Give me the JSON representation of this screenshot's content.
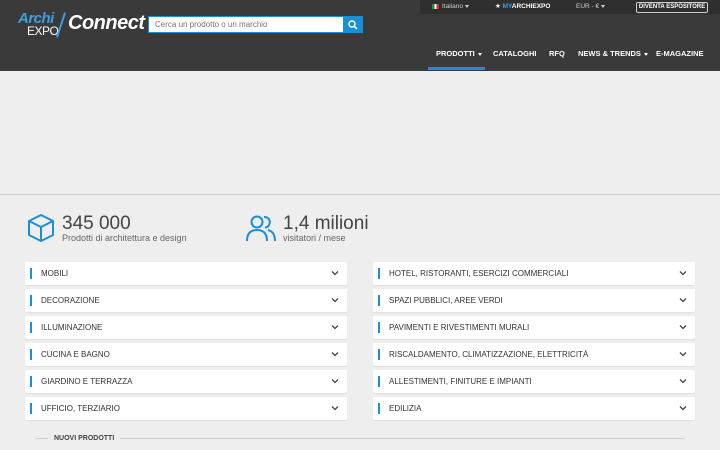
{
  "header": {
    "logo": {
      "archi": "Archi",
      "expo": "EXPO",
      "connect": "Connect"
    },
    "search": {
      "placeholder": "Cerca un prodotto o un marchio"
    },
    "topbar": {
      "language": "Italiano",
      "my_prefix": "MY",
      "my_site": "ARCHIEXPO",
      "currency": "EUR - €",
      "exhibitor_button": "DIVENTA ESPOSITORE"
    },
    "nav": [
      {
        "label": "PRODOTTI",
        "has_caret": true,
        "active": true
      },
      {
        "label": "CATALOGHI",
        "has_caret": false
      },
      {
        "label": "RFQ",
        "has_caret": false
      },
      {
        "label": "NEWS & TRENDS",
        "has_caret": true
      },
      {
        "label": "E-MAGAZINE",
        "has_caret": false
      }
    ]
  },
  "stats": [
    {
      "icon": "cube-icon",
      "value": "345 000",
      "caption": "Prodotti di architettura e design"
    },
    {
      "icon": "users-icon",
      "value": "1,4 milioni",
      "caption": "visitatori / mese"
    }
  ],
  "categories_left": [
    "MOBILI",
    "DECORAZIONE",
    "ILLUMINAZIONE",
    "CUCINA E BAGNO",
    "GIARDINO E TERRAZZA",
    "UFFICIO, TERZIARIO"
  ],
  "categories_right": [
    "HOTEL, RISTORANTI, ESERCIZI COMMERCIALI",
    "SPAZI PUBBLICI, AREE VERDI",
    "PAVIMENTI E RIVESTIMENTI MURALI",
    "RISCALDAMENTO, CLIMATIZZAZIONE, ELETTRICITÀ",
    "ALLESTIMENTI, FINITURE E IMPIANTI",
    "EDILIZIA"
  ],
  "section_new": "NUOVI PRODOTTI",
  "colors": {
    "accent": "#1a8fd6",
    "header_bg": "#3a3a3a",
    "page_bg": "#eeeeee"
  }
}
